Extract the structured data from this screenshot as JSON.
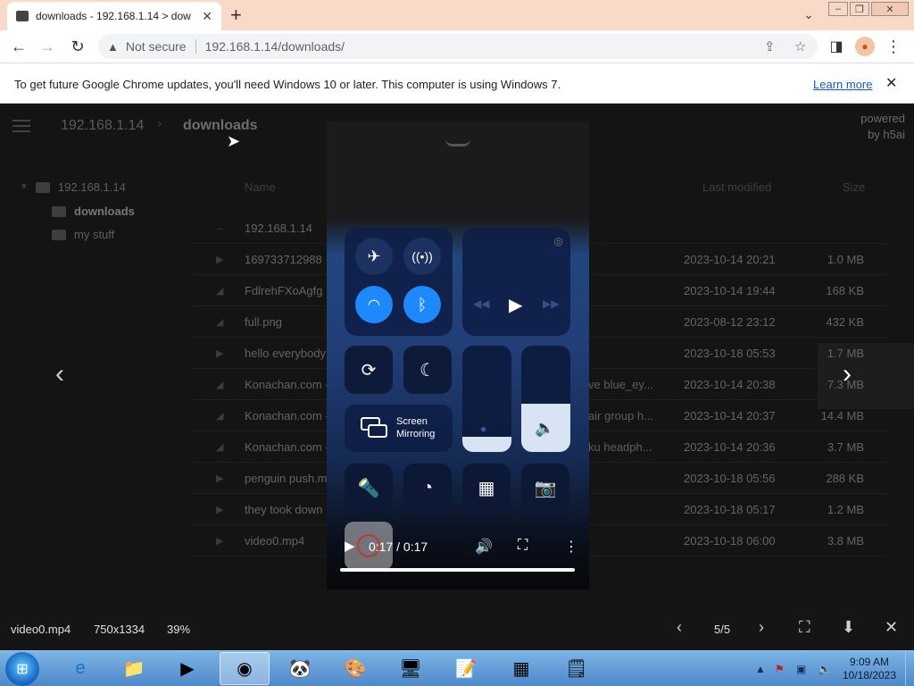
{
  "browser": {
    "tab_title": "downloads - 192.168.1.14 > dow",
    "not_secure": "Not secure",
    "url": "192.168.1.14/downloads/"
  },
  "infobar": {
    "message": "To get future Google Chrome updates, you'll need Windows 10 or later. This computer is using Windows 7.",
    "learn_more": "Learn more"
  },
  "h5ai": {
    "breadcrumb": [
      "192.168.1.14",
      "downloads"
    ],
    "powered_by": "powered by h5ai",
    "tree": [
      "192.168.1.14",
      "downloads",
      "my stuff"
    ],
    "columns": {
      "name": "Name",
      "modified": "Last modified",
      "size": "Size"
    },
    "parent": "192.168.1.14",
    "files": [
      {
        "name": "169733712988",
        "tail": "",
        "date": "2023-10-14 20:21",
        "size": "1.0 MB",
        "icon": "video"
      },
      {
        "name": "FdlrehFXoAgfg",
        "tail": "",
        "date": "2023-10-14 19:44",
        "size": "168 KB",
        "icon": "image"
      },
      {
        "name": "full.png",
        "tail": "",
        "date": "2023-08-12 23:12",
        "size": "432 KB",
        "icon": "image"
      },
      {
        "name": "hello everybody",
        "tail": "",
        "date": "2023-10-18 05:53",
        "size": "1.7 MB",
        "icon": "video"
      },
      {
        "name": "Konachan.com -",
        "tail": "ve blue_ey...",
        "date": "2023-10-14 20:38",
        "size": "7.3 MB",
        "icon": "image"
      },
      {
        "name": "Konachan.com -",
        "tail": "air group h...",
        "date": "2023-10-14 20:37",
        "size": "14.4 MB",
        "icon": "image"
      },
      {
        "name": "Konachan.com -",
        "tail": "ku headph...",
        "date": "2023-10-14 20:36",
        "size": "3.7 MB",
        "icon": "image"
      },
      {
        "name": "penguin push.m",
        "tail": "",
        "date": "2023-10-18 05:56",
        "size": "288 KB",
        "icon": "video"
      },
      {
        "name": "they took down",
        "tail": "",
        "date": "2023-10-18 05:17",
        "size": "1.2 MB",
        "icon": "video"
      },
      {
        "name": "video0.mp4",
        "tail": "",
        "date": "2023-10-18 06:00",
        "size": "3.8 MB",
        "icon": "video"
      }
    ]
  },
  "video": {
    "time": "0:17 / 0:17",
    "progress": 1.0,
    "screen_mirroring": "Screen Mirroring"
  },
  "preview_bar": {
    "filename": "video0.mp4",
    "dimensions": "750x1334",
    "zoom": "39%",
    "counter": "5/5"
  },
  "taskbar": {
    "time": "9:09 AM",
    "date": "10/18/2023"
  },
  "colors": {
    "accent_blue": "#1e88ff",
    "titlebar": "#f9d9c8",
    "link": "#1a56c9"
  }
}
